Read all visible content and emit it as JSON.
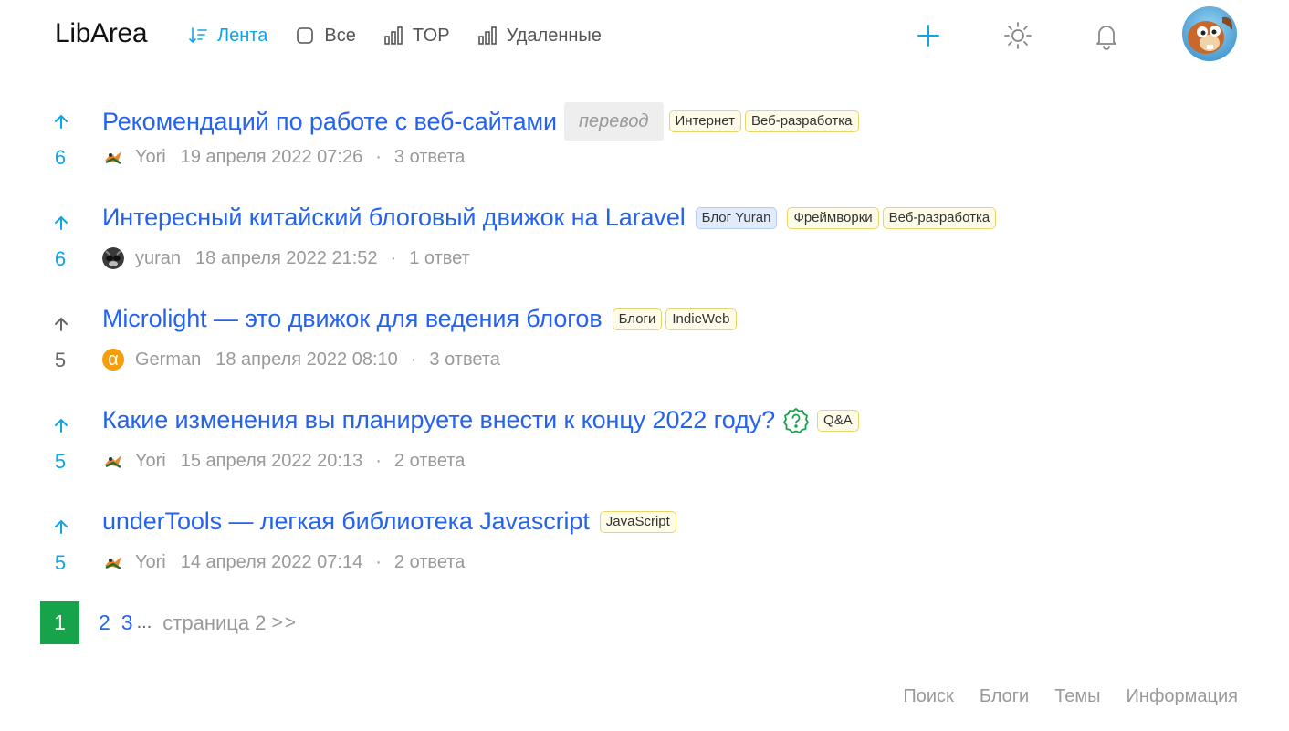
{
  "header": {
    "logo": "LibArea",
    "nav": [
      {
        "label": "Лента",
        "icon": "sort-icon",
        "active": true
      },
      {
        "label": "Все",
        "icon": "square-icon",
        "active": false
      },
      {
        "label": "TOP",
        "icon": "bar-chart-icon",
        "active": false
      },
      {
        "label": "Удаленные",
        "icon": "bar-chart-icon",
        "active": false
      }
    ],
    "actions": [
      "plus-icon",
      "sun-icon",
      "bell-icon"
    ],
    "accent_color": "#0ea5e9"
  },
  "posts": [
    {
      "title": "Рекомендаций по работе с веб-сайтами",
      "votes": "6",
      "label": "перевод",
      "tags": [
        "Интернет",
        "Веб-разработка"
      ],
      "author": "Yori",
      "date": "19 апреля 2022 07:26",
      "answers": "3 ответа"
    },
    {
      "title": "Интересный китайский блоговый движок на Laravel",
      "votes": "6",
      "blog": "Блог Yuran",
      "tags": [
        "Фреймворки",
        "Веб-разработка"
      ],
      "author": "yuran",
      "date": "18 апреля 2022 21:52",
      "answers": "1 ответ"
    },
    {
      "title": "Microlight — это движок для ведения блогов",
      "votes": "5",
      "tags": [
        "Блоги",
        "IndieWeb"
      ],
      "author": "German",
      "avatar_letter": "α",
      "date": "18 апреля 2022 08:10",
      "answers": "3 ответа"
    },
    {
      "title": "Какие изменения вы планируете внести к концу 2022 году?",
      "votes": "5",
      "tags": [
        "Q&A"
      ],
      "author": "Yori",
      "date": "15 апреля 2022 20:13",
      "answers": "2 ответа"
    },
    {
      "title": "underTools — легкая библиотека Javascript",
      "votes": "5",
      "tags": [
        "JavaScript"
      ],
      "author": "Yori",
      "date": "14 апреля 2022 07:14",
      "answers": "2 ответа"
    }
  ],
  "pagination": {
    "current": "1",
    "pages": [
      "2",
      "3"
    ],
    "ellipsis": "...",
    "info": "страница 2",
    "next": ">>",
    "active_color": "#16a34a"
  },
  "footer": {
    "links": [
      "Поиск",
      "Блоги",
      "Темы",
      "Информация"
    ]
  }
}
